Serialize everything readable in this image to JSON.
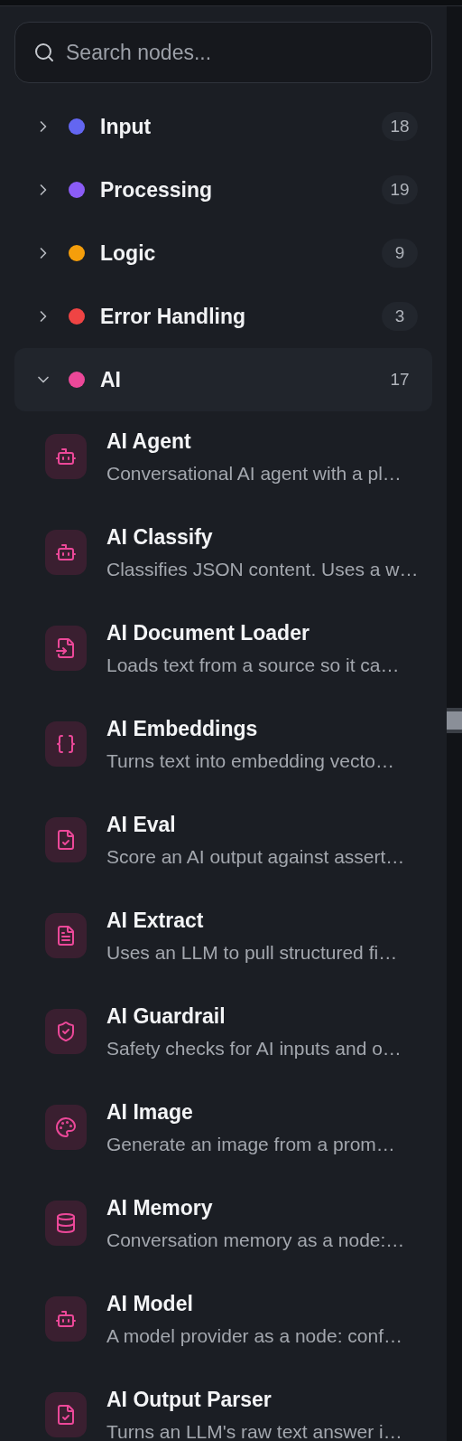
{
  "search": {
    "placeholder": "Search nodes..."
  },
  "categories": [
    {
      "label": "Input",
      "count": "18",
      "color": "#6366f1",
      "expanded": false
    },
    {
      "label": "Processing",
      "count": "19",
      "color": "#8b5cf6",
      "expanded": false
    },
    {
      "label": "Logic",
      "count": "9",
      "color": "#f59e0b",
      "expanded": false
    },
    {
      "label": "Error Handling",
      "count": "3",
      "color": "#ef4444",
      "expanded": false
    },
    {
      "label": "AI",
      "count": "17",
      "color": "#ec4899",
      "expanded": true,
      "items": [
        {
          "title": "AI Agent",
          "description": "Conversational AI agent with a pl…"
        },
        {
          "title": "AI Classify",
          "description": "Classifies JSON content. Uses a w…"
        },
        {
          "title": "AI Document Loader",
          "description": "Loads text from a source so it ca…"
        },
        {
          "title": "AI Embeddings",
          "description": "Turns text into embedding vecto…"
        },
        {
          "title": "AI Eval",
          "description": "Score an AI output against assert…"
        },
        {
          "title": "AI Extract",
          "description": "Uses an LLM to pull structured fi…"
        },
        {
          "title": "AI Guardrail",
          "description": "Safety checks for AI inputs and o…"
        },
        {
          "title": "AI Image",
          "description": "Generate an image from a prom…"
        },
        {
          "title": "AI Memory",
          "description": "Conversation memory as a node:…"
        },
        {
          "title": "AI Model",
          "description": "A model provider as a node: conf…"
        },
        {
          "title": "AI Output Parser",
          "description": "Turns an LLM's raw text answer i…"
        }
      ]
    }
  ]
}
